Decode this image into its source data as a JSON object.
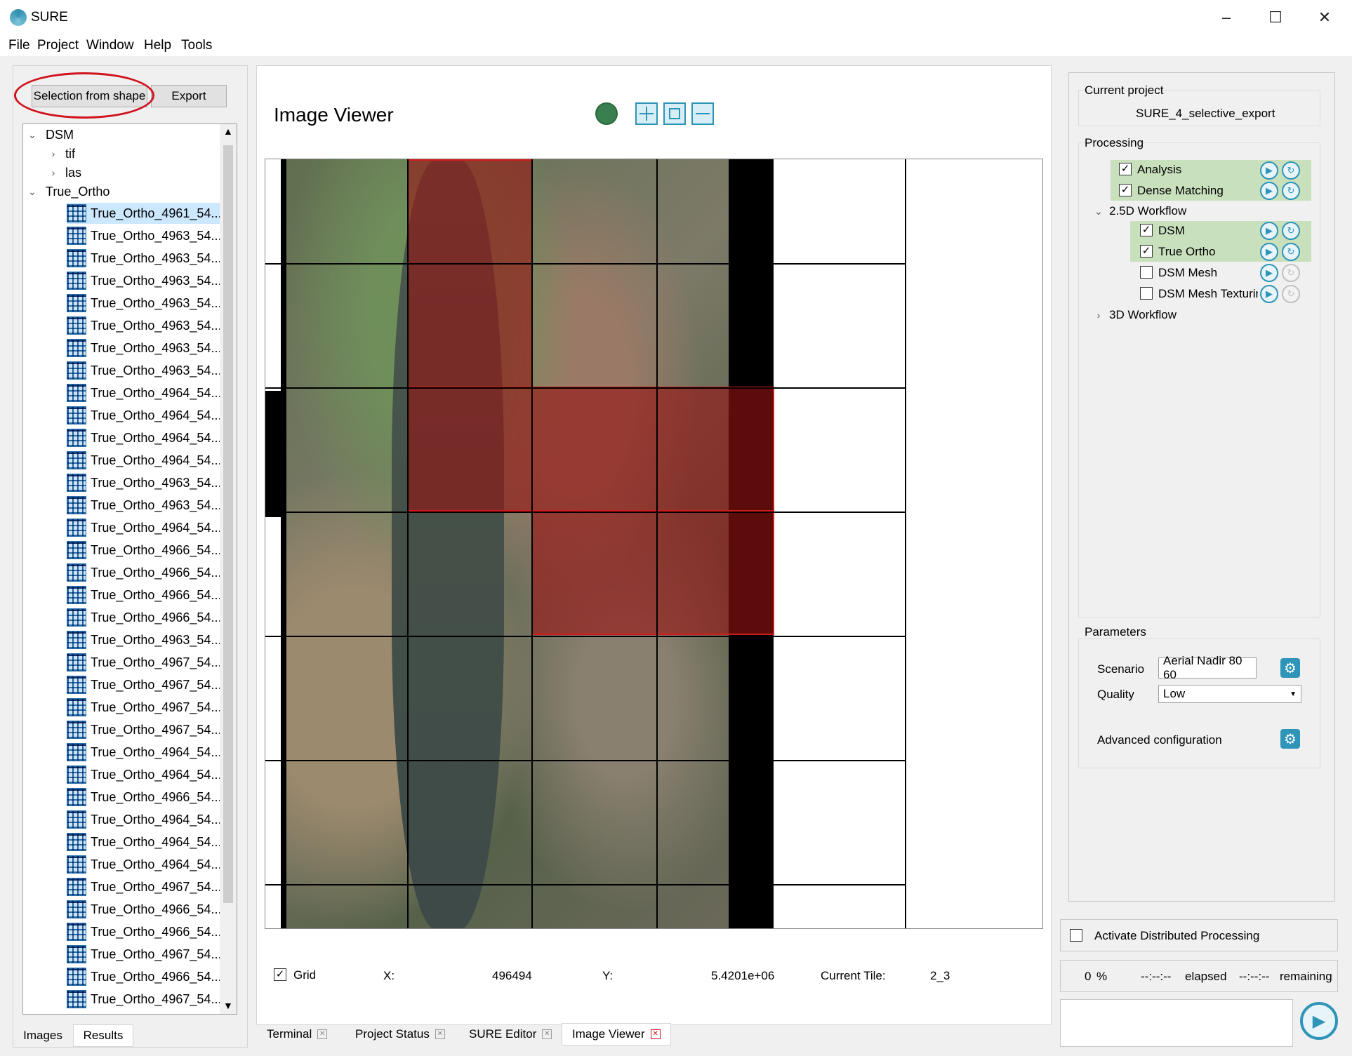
{
  "app": {
    "title": "SURE"
  },
  "menu": [
    "File",
    "Project",
    "Window",
    "Help",
    "Tools"
  ],
  "left": {
    "selection_button": "Selection from shape",
    "export_button": "Export",
    "tree": {
      "dsm_label": "DSM",
      "dsm_children": [
        "tif",
        "las"
      ],
      "true_ortho_label": "True_Ortho",
      "files": [
        "True_Ortho_4961_54...",
        "True_Ortho_4963_54...",
        "True_Ortho_4963_54...",
        "True_Ortho_4963_54...",
        "True_Ortho_4963_54...",
        "True_Ortho_4963_54...",
        "True_Ortho_4963_54...",
        "True_Ortho_4963_54...",
        "True_Ortho_4964_54...",
        "True_Ortho_4964_54...",
        "True_Ortho_4964_54...",
        "True_Ortho_4964_54...",
        "True_Ortho_4963_54...",
        "True_Ortho_4963_54...",
        "True_Ortho_4964_54...",
        "True_Ortho_4966_54...",
        "True_Ortho_4966_54...",
        "True_Ortho_4966_54...",
        "True_Ortho_4966_54...",
        "True_Ortho_4963_54...",
        "True_Ortho_4967_54...",
        "True_Ortho_4967_54...",
        "True_Ortho_4967_54...",
        "True_Ortho_4967_54...",
        "True_Ortho_4964_54...",
        "True_Ortho_4964_54...",
        "True_Ortho_4966_54...",
        "True_Ortho_4964_54...",
        "True_Ortho_4964_54...",
        "True_Ortho_4964_54...",
        "True_Ortho_4967_54...",
        "True_Ortho_4966_54...",
        "True_Ortho_4966_54...",
        "True_Ortho_4967_54...",
        "True_Ortho_4966_54...",
        "True_Ortho_4967_54..."
      ]
    },
    "tabs": [
      "Images",
      "Results"
    ]
  },
  "viewer": {
    "title": "Image Viewer",
    "grid_label": "Grid",
    "x_label": "X:",
    "x_value": "496494",
    "y_label": "Y:",
    "y_value": "5.4201e+06",
    "tile_label": "Current Tile:",
    "tile_value": "2_3"
  },
  "bottom_tabs": [
    "Terminal",
    "Project Status",
    "SURE Editor",
    "Image Viewer"
  ],
  "right": {
    "current_project_label": "Current project",
    "current_project_value": "SURE_4_selective_export",
    "processing_label": "Processing",
    "steps": {
      "analysis": "Analysis",
      "dense_matching": "Dense Matching",
      "workflow_25d": "2.5D Workflow",
      "dsm": "DSM",
      "true_ortho": "True Ortho",
      "dsm_mesh": "DSM Mesh",
      "dsm_mesh_texturing": "DSM Mesh Texturing",
      "workflow_3d": "3D Workflow"
    },
    "parameters_label": "Parameters",
    "scenario_label": "Scenario",
    "scenario_value": "Aerial Nadir 80 60",
    "quality_label": "Quality",
    "quality_value": "Low",
    "advanced_label": "Advanced configuration",
    "distributed_label": "Activate Distributed Processing",
    "progress_percent": "0",
    "progress_unit": "%",
    "elapsed_time": "--:--:--",
    "elapsed_label": "elapsed",
    "remaining_time": "--:--:--",
    "remaining_label": "remaining"
  },
  "colors": {
    "accent": "#2e94b8",
    "selection": "#d61a1a",
    "checked_bg": "#c9e0bd"
  }
}
